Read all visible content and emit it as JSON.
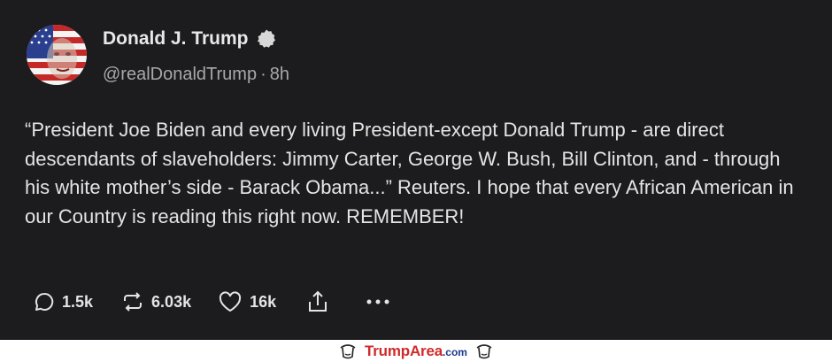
{
  "post": {
    "display_name": "Donald J. Trump",
    "handle": "@realDonaldTrump",
    "separator": "·",
    "time_ago": "8h",
    "text": "“President Joe Biden and every living President-except Donald Trump - are direct descendants of slaveholders: Jimmy Carter, George W. Bush, Bill Clinton, and - through his white mother’s side - Barack Obama...” Reuters. I hope that every African American in our Country is reading this right now. REMEMBER!",
    "avatar_icon": "flag-face-avatar",
    "verified_icon": "verified-badge-icon"
  },
  "actions": {
    "reply_count": "1.5k",
    "repost_count": "6.03k",
    "like_count": "16k",
    "icons": [
      "reply-icon",
      "repost-icon",
      "like-icon",
      "share-icon",
      "more-icon"
    ]
  },
  "watermark": {
    "brand_main": "TrumpArea",
    "brand_tld": ".com"
  },
  "colors": {
    "background": "#1c1c1e",
    "text": "#e4e4e4",
    "muted": "#a8a8a8",
    "brand_red": "#d12a2a",
    "brand_blue": "#1a3a8c"
  }
}
